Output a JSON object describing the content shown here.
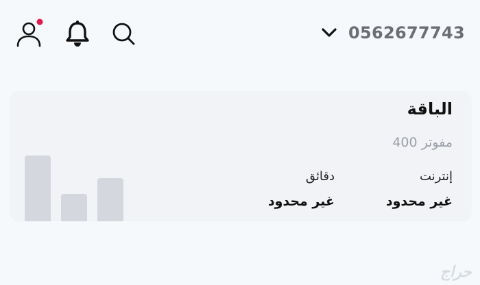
{
  "header": {
    "phone_number": "0562677743",
    "icons": {
      "profile": "user-profile-icon",
      "notification_dot_color": "#e0194f",
      "bell": "bell-icon",
      "search": "search-icon",
      "chevron": "chevron-down-icon"
    }
  },
  "plan": {
    "title": "الباقة",
    "subtitle": "مفوتر 400",
    "allowances": [
      {
        "label": "إنترنت",
        "value": "غير محدود"
      },
      {
        "label": "دقائق",
        "value": "غير محدود"
      }
    ],
    "chart_bar_color": "#d4d8de"
  },
  "watermark": "حراج"
}
